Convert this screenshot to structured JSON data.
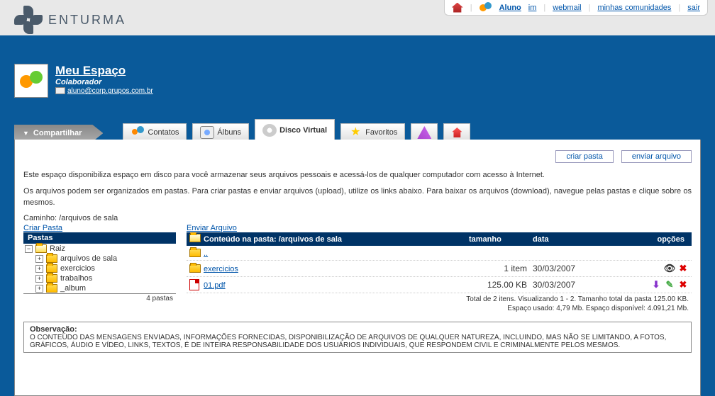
{
  "brand": "ENTURMA",
  "topnav": {
    "aluno": "Aluno",
    "im": "im",
    "webmail": "webmail",
    "comunidades": "minhas comunidades",
    "sair": "sair"
  },
  "profile": {
    "title": "Meu Espaço",
    "role": "Colaborador",
    "email": "aluno@corp.grupos.com.br"
  },
  "tabs": {
    "share": "Compartilhar",
    "contatos": "Contatos",
    "albuns": "Álbuns",
    "disco": "Disco Virtual",
    "favoritos": "Favoritos"
  },
  "actions": {
    "criar_pasta": "criar pasta",
    "enviar_arquivo": "enviar arquivo"
  },
  "intro1": "Este espaço disponibiliza espaço em disco para você armazenar seus arquivos pessoais e acessá-los de qualquer computador com acesso à Internet.",
  "intro2": "Os arquivos podem ser organizados em pastas. Para criar pastas e enviar arquivos (upload), utilize os links abaixo. Para baixar os arquivos (download), navegue pelas pastas e clique sobre os mesmos.",
  "path_label": "Caminho: /arquivos de sala",
  "links": {
    "criar_pasta": "Criar Pasta",
    "enviar_arquivo": "Enviar Arquivo"
  },
  "tree": {
    "header": "Pastas",
    "root": "Raiz",
    "items": [
      "arquivos de sala",
      "exercicios",
      "trabalhos",
      "_album"
    ],
    "footer": "4 pastas"
  },
  "files": {
    "header_content": "Conteúdo na pasta: /arquivos de sala",
    "header_size": "tamanho",
    "header_date": "data",
    "header_opts": "opções",
    "up": "..",
    "rows": [
      {
        "name": "exercicios",
        "size": "1 item",
        "date": "30/03/2007",
        "type": "folder"
      },
      {
        "name": "01.pdf",
        "size": "125.00 KB",
        "date": "30/03/2007",
        "type": "pdf"
      }
    ],
    "footer1": "Total de 2 itens. Visualizando 1 - 2. Tamanho total da pasta 125.00 KB.",
    "footer2": "Espaço usado: 4,79 Mb. Espaço disponível: 4.091,21 Mb."
  },
  "obs": {
    "title": "Observação:",
    "body": "O CONTEÚDO DAS MENSAGENS ENVIADAS, INFORMAÇÕES FORNECIDAS, DISPONIBILIZAÇÃO DE ARQUIVOS DE QUALQUER NATUREZA, INCLUINDO, MAS NÃO SE LIMITANDO, A FOTOS, GRÁFICOS, ÁUDIO E VÍDEO, LINKS, TEXTOS, É DE INTEIRA RESPONSABILIDADE DOS USUÁRIOS INDIVIDUAIS, QUE RESPONDEM CIVIL E CRIMINALMENTE PELOS MESMOS."
  }
}
